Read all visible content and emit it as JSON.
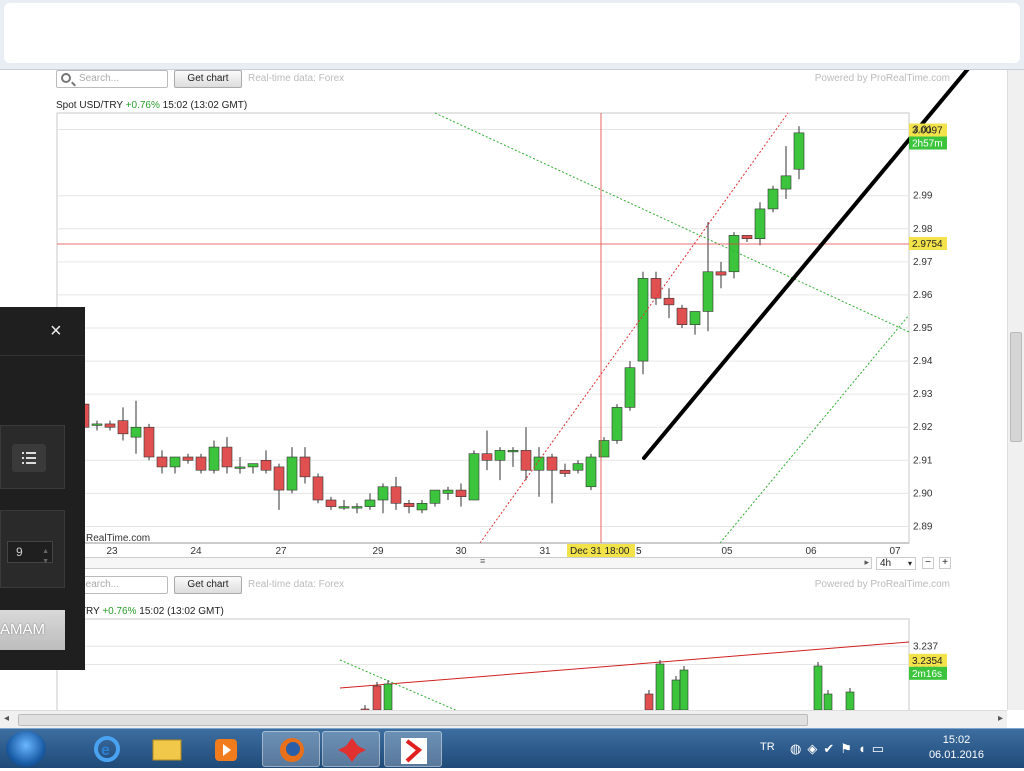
{
  "browser": {
    "tab_icons": [
      "minimize-icon",
      "close-icon"
    ]
  },
  "chart1": {
    "search_placeholder": "Search...",
    "get_chart": "Get chart",
    "realtime": "Real-time data: Forex",
    "powered": "Powered by ProRealTime.com",
    "symbol": "Spot USD/TRY",
    "change": "+0.76%",
    "time": "15:02",
    "gmt": "(13:02 GMT)",
    "watermark": "RealTime.com",
    "period": "4h",
    "price_tag": "3.0097",
    "countdown": "2h57m",
    "cursor_tag": "2.9754",
    "cursor_date": "Dec 31 18:00",
    "cursor_date_suffix": "5"
  },
  "chart2": {
    "search_placeholder": "Search...",
    "get_chart": "Get chart",
    "realtime": "Real-time data: Forex",
    "powered": "Powered by ProRealTime.com",
    "symbol": "EUR/TRY",
    "change": "+0.76%",
    "time": "15:02",
    "gmt": "(13:02 GMT)",
    "price_tag": "3.2354",
    "countdown": "2m16s"
  },
  "modal": {
    "close": "×",
    "number": "9",
    "ok": "AMAM"
  },
  "taskbar": {
    "lang": "TR",
    "time": "15:02",
    "date": "06.01.2016"
  },
  "colors": {
    "up": "#3cc43c",
    "down": "#e05050",
    "tag": "#f2e34a",
    "countdown": "#3cc43c"
  },
  "chart_data": [
    {
      "type": "candlestick",
      "title": "Spot USD/TRY",
      "x_ticks": [
        "23",
        "24",
        "27",
        "29",
        "30",
        "31",
        "05",
        "06",
        "07"
      ],
      "ylim": [
        2.885,
        3.015
      ],
      "y_ticks": [
        2.89,
        2.9,
        2.91,
        2.92,
        2.93,
        2.94,
        2.95,
        2.96,
        2.97,
        2.98,
        2.99,
        3.01
      ],
      "last_price": 3.0097,
      "cursor_price": 2.9754,
      "candles": [
        {
          "o": 2.927,
          "h": 2.928,
          "l": 2.918,
          "c": 2.92
        },
        {
          "o": 2.921,
          "h": 2.922,
          "l": 2.919,
          "c": 2.921
        },
        {
          "o": 2.921,
          "h": 2.922,
          "l": 2.919,
          "c": 2.92
        },
        {
          "o": 2.922,
          "h": 2.926,
          "l": 2.916,
          "c": 2.918
        },
        {
          "o": 2.917,
          "h": 2.928,
          "l": 2.912,
          "c": 2.92
        },
        {
          "o": 2.92,
          "h": 2.921,
          "l": 2.91,
          "c": 2.911
        },
        {
          "o": 2.911,
          "h": 2.913,
          "l": 2.906,
          "c": 2.908
        },
        {
          "o": 2.908,
          "h": 2.911,
          "l": 2.906,
          "c": 2.911
        },
        {
          "o": 2.911,
          "h": 2.912,
          "l": 2.909,
          "c": 2.91
        },
        {
          "o": 2.911,
          "h": 2.912,
          "l": 2.906,
          "c": 2.907
        },
        {
          "o": 2.907,
          "h": 2.916,
          "l": 2.906,
          "c": 2.914
        },
        {
          "o": 2.914,
          "h": 2.917,
          "l": 2.906,
          "c": 2.908
        },
        {
          "o": 2.908,
          "h": 2.911,
          "l": 2.906,
          "c": 2.908
        },
        {
          "o": 2.908,
          "h": 2.909,
          "l": 2.906,
          "c": 2.909
        },
        {
          "o": 2.91,
          "h": 2.913,
          "l": 2.906,
          "c": 2.907
        },
        {
          "o": 2.908,
          "h": 2.909,
          "l": 2.895,
          "c": 2.901
        },
        {
          "o": 2.901,
          "h": 2.914,
          "l": 2.9,
          "c": 2.911
        },
        {
          "o": 2.911,
          "h": 2.914,
          "l": 2.903,
          "c": 2.905
        },
        {
          "o": 2.905,
          "h": 2.906,
          "l": 2.897,
          "c": 2.898
        },
        {
          "o": 2.898,
          "h": 2.899,
          "l": 2.895,
          "c": 2.896
        },
        {
          "o": 2.896,
          "h": 2.898,
          "l": 2.895,
          "c": 2.896
        },
        {
          "o": 2.896,
          "h": 2.897,
          "l": 2.894,
          "c": 2.896
        },
        {
          "o": 2.896,
          "h": 2.9,
          "l": 2.895,
          "c": 2.898
        },
        {
          "o": 2.898,
          "h": 2.903,
          "l": 2.894,
          "c": 2.902
        },
        {
          "o": 2.902,
          "h": 2.905,
          "l": 2.895,
          "c": 2.897
        },
        {
          "o": 2.897,
          "h": 2.898,
          "l": 2.894,
          "c": 2.896
        },
        {
          "o": 2.895,
          "h": 2.898,
          "l": 2.894,
          "c": 2.897
        },
        {
          "o": 2.897,
          "h": 2.901,
          "l": 2.896,
          "c": 2.901
        },
        {
          "o": 2.9,
          "h": 2.902,
          "l": 2.898,
          "c": 2.901
        },
        {
          "o": 2.901,
          "h": 2.903,
          "l": 2.896,
          "c": 2.899
        },
        {
          "o": 2.898,
          "h": 2.913,
          "l": 2.898,
          "c": 2.912
        },
        {
          "o": 2.912,
          "h": 2.919,
          "l": 2.907,
          "c": 2.91
        },
        {
          "o": 2.91,
          "h": 2.914,
          "l": 2.904,
          "c": 2.913
        },
        {
          "o": 2.913,
          "h": 2.914,
          "l": 2.908,
          "c": 2.913
        },
        {
          "o": 2.913,
          "h": 2.92,
          "l": 2.904,
          "c": 2.907
        },
        {
          "o": 2.907,
          "h": 2.914,
          "l": 2.899,
          "c": 2.911
        },
        {
          "o": 2.911,
          "h": 2.912,
          "l": 2.897,
          "c": 2.907
        },
        {
          "o": 2.907,
          "h": 2.909,
          "l": 2.905,
          "c": 2.906
        },
        {
          "o": 2.907,
          "h": 2.91,
          "l": 2.906,
          "c": 2.909
        },
        {
          "o": 2.902,
          "h": 2.912,
          "l": 2.901,
          "c": 2.911
        },
        {
          "o": 2.911,
          "h": 2.917,
          "l": 2.911,
          "c": 2.916
        },
        {
          "o": 2.916,
          "h": 2.927,
          "l": 2.915,
          "c": 2.926
        },
        {
          "o": 2.926,
          "h": 2.94,
          "l": 2.925,
          "c": 2.938
        },
        {
          "o": 2.94,
          "h": 2.967,
          "l": 2.936,
          "c": 2.965
        },
        {
          "o": 2.965,
          "h": 2.967,
          "l": 2.957,
          "c": 2.959
        },
        {
          "o": 2.959,
          "h": 2.962,
          "l": 2.953,
          "c": 2.957
        },
        {
          "o": 2.956,
          "h": 2.957,
          "l": 2.95,
          "c": 2.951
        },
        {
          "o": 2.951,
          "h": 2.955,
          "l": 2.948,
          "c": 2.955
        },
        {
          "o": 2.955,
          "h": 2.982,
          "l": 2.949,
          "c": 2.967
        },
        {
          "o": 2.967,
          "h": 2.97,
          "l": 2.962,
          "c": 2.966
        },
        {
          "o": 2.967,
          "h": 2.979,
          "l": 2.965,
          "c": 2.978
        },
        {
          "o": 2.978,
          "h": 2.978,
          "l": 2.976,
          "c": 2.977
        },
        {
          "o": 2.977,
          "h": 2.988,
          "l": 2.975,
          "c": 2.986
        },
        {
          "o": 2.986,
          "h": 2.993,
          "l": 2.985,
          "c": 2.992
        },
        {
          "o": 2.992,
          "h": 3.005,
          "l": 2.989,
          "c": 2.996
        },
        {
          "o": 2.998,
          "h": 3.011,
          "l": 2.995,
          "c": 3.009
        }
      ]
    },
    {
      "type": "candlestick",
      "title": "EUR/TRY",
      "ylim": [
        3.229,
        3.24
      ],
      "y_ticks": [
        3.235,
        3.237
      ],
      "last_price": 3.2354
    }
  ]
}
